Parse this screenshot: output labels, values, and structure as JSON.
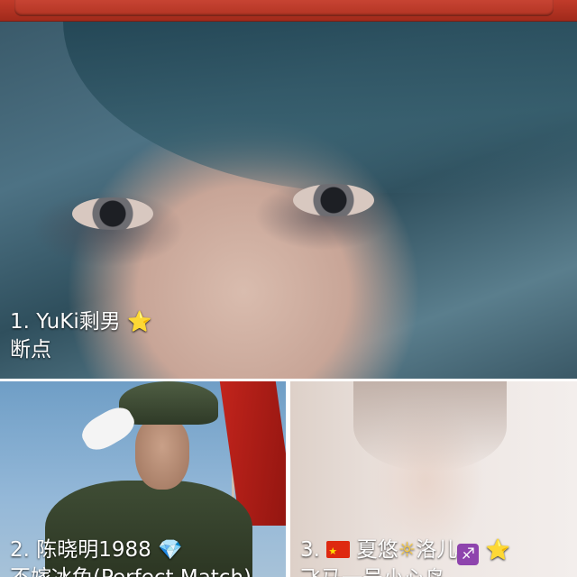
{
  "header": {
    "search_label": ""
  },
  "cards": [
    {
      "index": "1.",
      "name": "YuKi剩男",
      "badge": "⭐",
      "subtitle": "断点"
    },
    {
      "index": "2.",
      "name": "陈晓明1988",
      "badge": "💎",
      "subtitle": "不嫁冰兔(Perfect Match)"
    },
    {
      "index": "3.",
      "flag": "🇨🇳",
      "name_part1": "夏悠",
      "sun": "☼",
      "name_part2": "洛儿",
      "zodiac": "♐",
      "badge": "⭐",
      "subtitle": "飞马一号小心鸟"
    }
  ],
  "colors": {
    "header_red": "#b23423",
    "star": "#f5b82a",
    "gem": "#7fd3f5",
    "zodiac_purple": "#8e44ad"
  },
  "icons": {
    "star": "star-emoji",
    "gem": "gem-emoji",
    "flag": "china-flag-emoji",
    "sun": "sun-emoji",
    "zodiac": "sagittarius-emoji"
  }
}
